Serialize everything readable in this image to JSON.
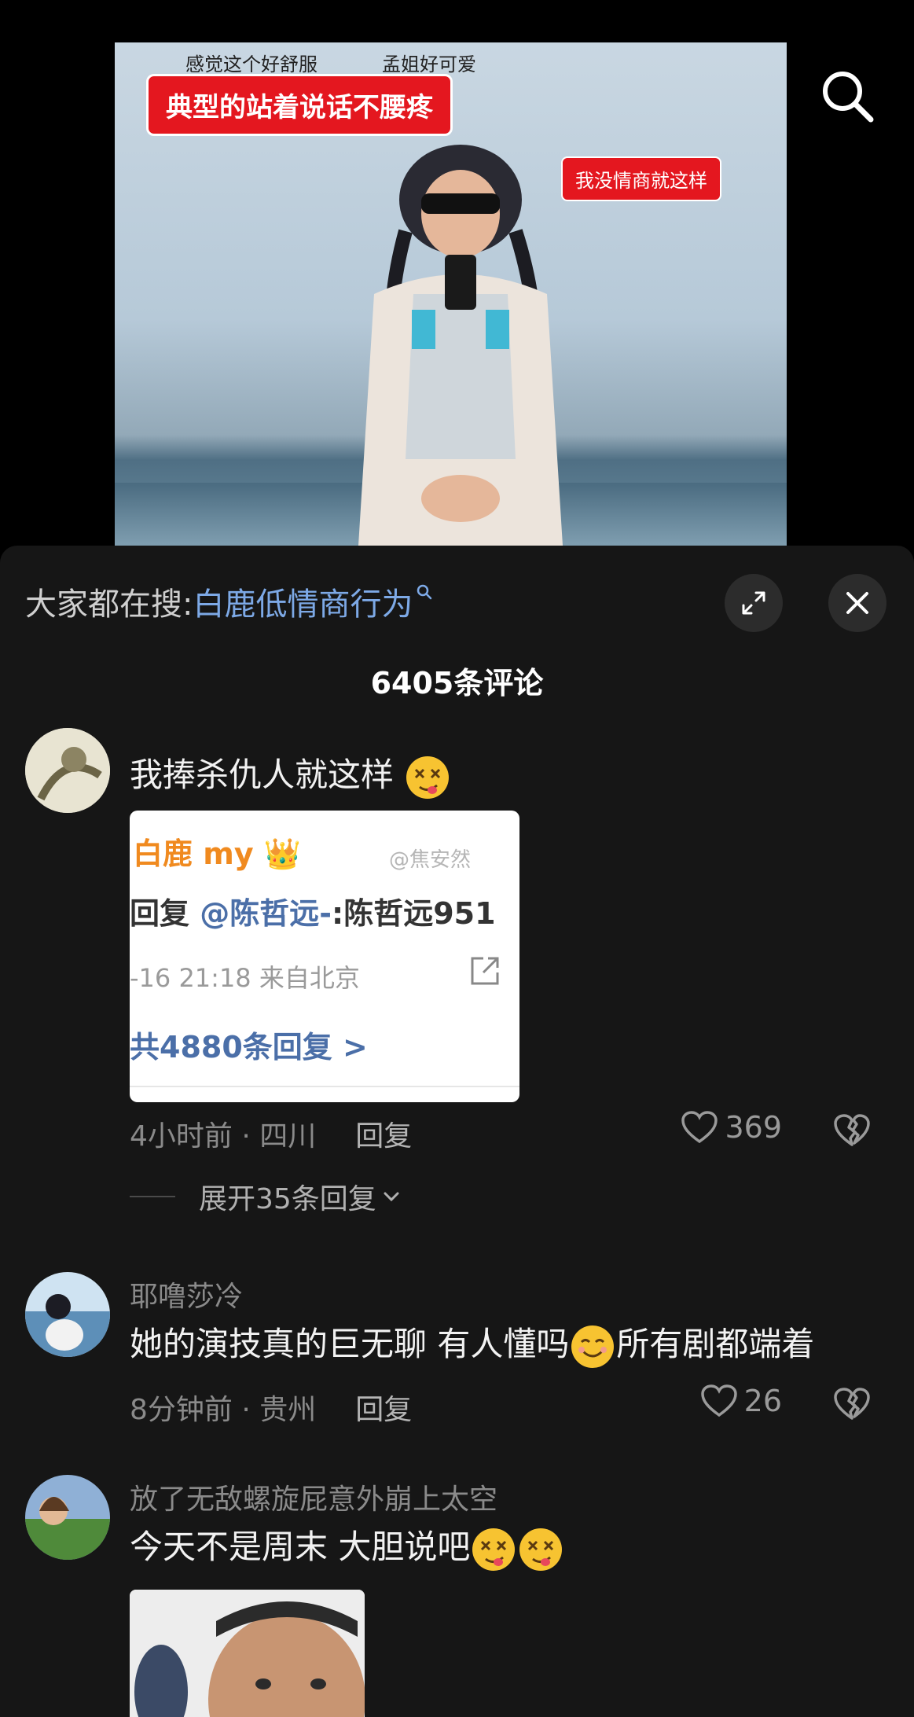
{
  "video": {
    "danmaku": [
      "感觉这个好舒服",
      "孟姐好可爱"
    ],
    "title_banner": "典型的站着说话不腰疼",
    "subtitle_banner": "我没情商就这样"
  },
  "search_suggest": {
    "prefix": "大家都在搜:",
    "term": "白鹿低情商行为"
  },
  "comment_count": "6405条评论",
  "comments": [
    {
      "text": "我捧杀仇人就这样",
      "image": {
        "line1": "白鹿 my 👑",
        "watermark": "@焦安然",
        "line2_prefix": "回复 ",
        "line2_at": "@陈哲远-",
        "line2_suffix": ":陈哲远951",
        "line3": "-16 21:18  来自北京",
        "line4": "共4880条回复 >"
      },
      "meta": "4小时前 · 四川",
      "reply": "回复",
      "likes": "369",
      "expand": "展开35条回复"
    },
    {
      "user": "耶噜莎冷",
      "text_a": "她的演技真的巨无聊 有人懂吗",
      "text_b": "所有剧都端着",
      "meta": "8分钟前 · 贵州",
      "reply": "回复",
      "likes": "26"
    },
    {
      "user": "放了无敌螺旋屁意外崩上太空",
      "text": "今天不是周末 大胆说吧"
    }
  ],
  "icons": {
    "search": "search-icon",
    "expand": "expand-icon",
    "close": "close-icon",
    "like": "heart-icon",
    "dislike": "broken-heart-icon"
  },
  "colors": {
    "sheet_bg": "#161616",
    "link_blue": "#7da9e6",
    "banner_red": "#e4171f"
  }
}
